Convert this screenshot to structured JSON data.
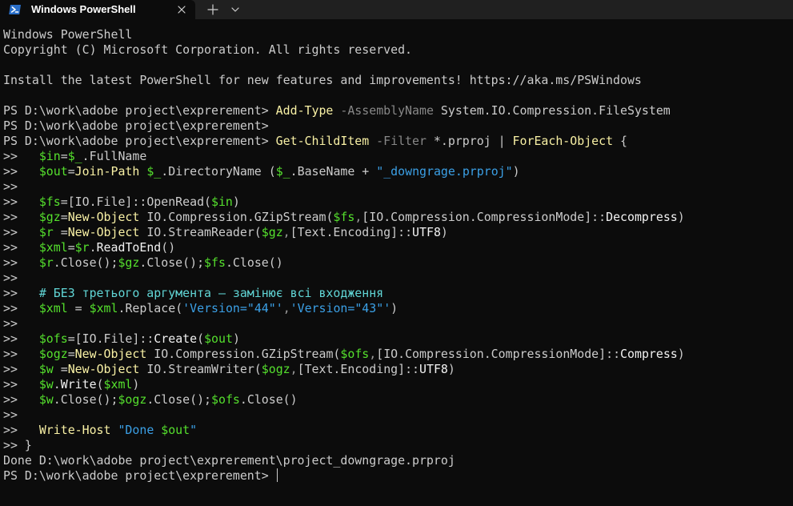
{
  "window": {
    "tab_title": "Windows PowerShell",
    "new_tab_glyph": "+",
    "icons": {
      "tab_icon": "powershell-icon",
      "close": "close-icon",
      "new_tab": "plus-icon",
      "dropdown": "chevron-down-icon"
    }
  },
  "colors": {
    "background": "#0c0c0c",
    "titlebar": "#202020",
    "text": "#cccccc",
    "command": "#f9f1a5",
    "parameter": "#888888",
    "variable": "#55e02d",
    "string": "#3ba0e6",
    "comment": "#61d6d6"
  },
  "terminal": {
    "lines": [
      [
        {
          "t": "Windows PowerShell",
          "c": "w"
        }
      ],
      [
        {
          "t": "Copyright (C) Microsoft Corporation. All rights reserved.",
          "c": "w"
        }
      ],
      [
        {
          "t": "",
          "c": "w"
        }
      ],
      [
        {
          "t": "Install the latest PowerShell for new features and improvements! https://aka.ms/PSWindows",
          "c": "w"
        }
      ],
      [
        {
          "t": "",
          "c": "w"
        }
      ],
      [
        {
          "t": "PS D:\\work\\adobe project\\exprerement> ",
          "c": "w"
        },
        {
          "t": "Add-Type",
          "c": "y"
        },
        {
          "t": " -AssemblyName",
          "c": "g"
        },
        {
          "t": " System.IO.Compression.FileSystem",
          "c": "w"
        }
      ],
      [
        {
          "t": "PS D:\\work\\adobe project\\exprerement>",
          "c": "w"
        }
      ],
      [
        {
          "t": "PS D:\\work\\adobe project\\exprerement> ",
          "c": "w"
        },
        {
          "t": "Get-ChildItem",
          "c": "y"
        },
        {
          "t": " -Filter",
          "c": "g"
        },
        {
          "t": " *.prproj ",
          "c": "w"
        },
        {
          "t": "|",
          "c": "w"
        },
        {
          "t": " ForEach-Object",
          "c": "y"
        },
        {
          "t": " {",
          "c": "w"
        }
      ],
      [
        {
          "t": ">>   ",
          "c": "w"
        },
        {
          "t": "$in",
          "c": "v"
        },
        {
          "t": "=",
          "c": "w"
        },
        {
          "t": "$_",
          "c": "v"
        },
        {
          "t": ".FullName",
          "c": "w"
        }
      ],
      [
        {
          "t": ">>   ",
          "c": "w"
        },
        {
          "t": "$out",
          "c": "v"
        },
        {
          "t": "=",
          "c": "w"
        },
        {
          "t": "Join-Path",
          "c": "y"
        },
        {
          "t": " ",
          "c": "w"
        },
        {
          "t": "$_",
          "c": "v"
        },
        {
          "t": ".DirectoryName (",
          "c": "w"
        },
        {
          "t": "$_",
          "c": "v"
        },
        {
          "t": ".BaseName + ",
          "c": "w"
        },
        {
          "t": "\"_downgrage.prproj\"",
          "c": "s"
        },
        {
          "t": ")",
          "c": "w"
        }
      ],
      [
        {
          "t": ">>",
          "c": "w"
        }
      ],
      [
        {
          "t": ">>   ",
          "c": "w"
        },
        {
          "t": "$fs",
          "c": "v"
        },
        {
          "t": "=[IO.File]::OpenRead(",
          "c": "w"
        },
        {
          "t": "$in",
          "c": "v"
        },
        {
          "t": ")",
          "c": "w"
        }
      ],
      [
        {
          "t": ">>   ",
          "c": "w"
        },
        {
          "t": "$gz",
          "c": "v"
        },
        {
          "t": "=",
          "c": "w"
        },
        {
          "t": "New-Object",
          "c": "y"
        },
        {
          "t": " IO.Compression.GZipStream(",
          "c": "w"
        },
        {
          "t": "$fs",
          "c": "v"
        },
        {
          "t": ",",
          "c": "x"
        },
        {
          "t": "[IO.Compression.CompressionMode]::",
          "c": "w"
        },
        {
          "t": "Decompress",
          "c": "k"
        },
        {
          "t": ")",
          "c": "w"
        }
      ],
      [
        {
          "t": ">>   ",
          "c": "w"
        },
        {
          "t": "$r",
          "c": "v"
        },
        {
          "t": " =",
          "c": "w"
        },
        {
          "t": "New-Object",
          "c": "y"
        },
        {
          "t": " IO.StreamReader(",
          "c": "w"
        },
        {
          "t": "$gz",
          "c": "v"
        },
        {
          "t": ",",
          "c": "x"
        },
        {
          "t": "[Text.Encoding]::",
          "c": "w"
        },
        {
          "t": "UTF8",
          "c": "k"
        },
        {
          "t": ")",
          "c": "w"
        }
      ],
      [
        {
          "t": ">>   ",
          "c": "w"
        },
        {
          "t": "$xml",
          "c": "v"
        },
        {
          "t": "=",
          "c": "w"
        },
        {
          "t": "$r",
          "c": "v"
        },
        {
          "t": ".",
          "c": "w"
        },
        {
          "t": "ReadToEnd",
          "c": "k"
        },
        {
          "t": "()",
          "c": "w"
        }
      ],
      [
        {
          "t": ">>   ",
          "c": "w"
        },
        {
          "t": "$r",
          "c": "v"
        },
        {
          "t": ".Close();",
          "c": "w"
        },
        {
          "t": "$gz",
          "c": "v"
        },
        {
          "t": ".Close();",
          "c": "w"
        },
        {
          "t": "$fs",
          "c": "v"
        },
        {
          "t": ".Close()",
          "c": "w"
        }
      ],
      [
        {
          "t": ">>",
          "c": "w"
        }
      ],
      [
        {
          "t": ">>   ",
          "c": "w"
        },
        {
          "t": "# БЕЗ третього аргумента — замінює всі входження",
          "c": "c"
        }
      ],
      [
        {
          "t": ">>   ",
          "c": "w"
        },
        {
          "t": "$xml",
          "c": "v"
        },
        {
          "t": " = ",
          "c": "w"
        },
        {
          "t": "$xml",
          "c": "v"
        },
        {
          "t": ".Replace(",
          "c": "w"
        },
        {
          "t": "'Version=\"44\"'",
          "c": "s"
        },
        {
          "t": ",",
          "c": "x"
        },
        {
          "t": "'Version=\"43\"'",
          "c": "s"
        },
        {
          "t": ")",
          "c": "w"
        }
      ],
      [
        {
          "t": ">>",
          "c": "w"
        }
      ],
      [
        {
          "t": ">>   ",
          "c": "w"
        },
        {
          "t": "$ofs",
          "c": "v"
        },
        {
          "t": "=[IO.File]::",
          "c": "w"
        },
        {
          "t": "Create",
          "c": "k"
        },
        {
          "t": "(",
          "c": "w"
        },
        {
          "t": "$out",
          "c": "v"
        },
        {
          "t": ")",
          "c": "w"
        }
      ],
      [
        {
          "t": ">>   ",
          "c": "w"
        },
        {
          "t": "$ogz",
          "c": "v"
        },
        {
          "t": "=",
          "c": "w"
        },
        {
          "t": "New-Object",
          "c": "y"
        },
        {
          "t": " IO.Compression.GZipStream(",
          "c": "w"
        },
        {
          "t": "$ofs",
          "c": "v"
        },
        {
          "t": ",",
          "c": "x"
        },
        {
          "t": "[IO.Compression.CompressionMode]::",
          "c": "w"
        },
        {
          "t": "Compress",
          "c": "k"
        },
        {
          "t": ")",
          "c": "w"
        }
      ],
      [
        {
          "t": ">>   ",
          "c": "w"
        },
        {
          "t": "$w",
          "c": "v"
        },
        {
          "t": " =",
          "c": "w"
        },
        {
          "t": "New-Object",
          "c": "y"
        },
        {
          "t": " IO.StreamWriter(",
          "c": "w"
        },
        {
          "t": "$ogz",
          "c": "v"
        },
        {
          "t": ",",
          "c": "x"
        },
        {
          "t": "[Text.Encoding]::",
          "c": "w"
        },
        {
          "t": "UTF8",
          "c": "k"
        },
        {
          "t": ")",
          "c": "w"
        }
      ],
      [
        {
          "t": ">>   ",
          "c": "w"
        },
        {
          "t": "$w",
          "c": "v"
        },
        {
          "t": ".",
          "c": "w"
        },
        {
          "t": "Write",
          "c": "k"
        },
        {
          "t": "(",
          "c": "w"
        },
        {
          "t": "$xml",
          "c": "v"
        },
        {
          "t": ")",
          "c": "w"
        }
      ],
      [
        {
          "t": ">>   ",
          "c": "w"
        },
        {
          "t": "$w",
          "c": "v"
        },
        {
          "t": ".Close();",
          "c": "w"
        },
        {
          "t": "$ogz",
          "c": "v"
        },
        {
          "t": ".Close();",
          "c": "w"
        },
        {
          "t": "$ofs",
          "c": "v"
        },
        {
          "t": ".Close()",
          "c": "w"
        }
      ],
      [
        {
          "t": ">>",
          "c": "w"
        }
      ],
      [
        {
          "t": ">>   ",
          "c": "w"
        },
        {
          "t": "Write-Host",
          "c": "y"
        },
        {
          "t": " ",
          "c": "w"
        },
        {
          "t": "\"Done ",
          "c": "s"
        },
        {
          "t": "$out",
          "c": "v"
        },
        {
          "t": "\"",
          "c": "s"
        }
      ],
      [
        {
          "t": ">> }",
          "c": "w"
        }
      ],
      [
        {
          "t": "Done D:\\work\\adobe project\\exprerement\\project_downgrage.prproj",
          "c": "w"
        }
      ],
      [
        {
          "t": "PS D:\\work\\adobe project\\exprerement> ",
          "c": "w"
        }
      ]
    ]
  }
}
